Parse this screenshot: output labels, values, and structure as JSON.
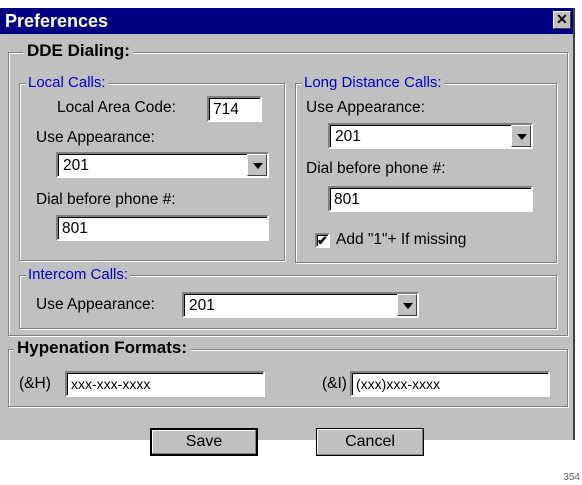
{
  "window": {
    "title": "Preferences",
    "close_glyph": "✕"
  },
  "dde": {
    "legend": "DDE Dialing:",
    "local": {
      "legend": "Local Calls:",
      "area_code_label": "Local Area Code:",
      "area_code_value": "714",
      "appearance_label": "Use Appearance:",
      "appearance_value": "201",
      "dial_before_label": "Dial before phone #:",
      "dial_before_value": "801"
    },
    "long_distance": {
      "legend": "Long Distance Calls:",
      "appearance_label": "Use Appearance:",
      "appearance_value": "201",
      "dial_before_label": "Dial before phone #:",
      "dial_before_value": "801",
      "add_one_label": "Add \"1\"+ If missing",
      "add_one_checked": true,
      "check_glyph": "✔"
    },
    "intercom": {
      "legend": "Intercom Calls:",
      "appearance_label": "Use Appearance:",
      "appearance_value": "201"
    }
  },
  "hyphenation": {
    "legend": "Hypenation Formats:",
    "h_label": "(&H)",
    "h_value": "xxx-xxx-xxxx",
    "i_label": "(&I)",
    "i_value": "(xxx)xxx-xxxx"
  },
  "buttons": {
    "save": "Save",
    "cancel": "Cancel"
  },
  "figure_number": "354",
  "colors": {
    "titlebar": "#000080",
    "group_legend_blue": "#0000cc",
    "face": "#c0c0c0"
  }
}
